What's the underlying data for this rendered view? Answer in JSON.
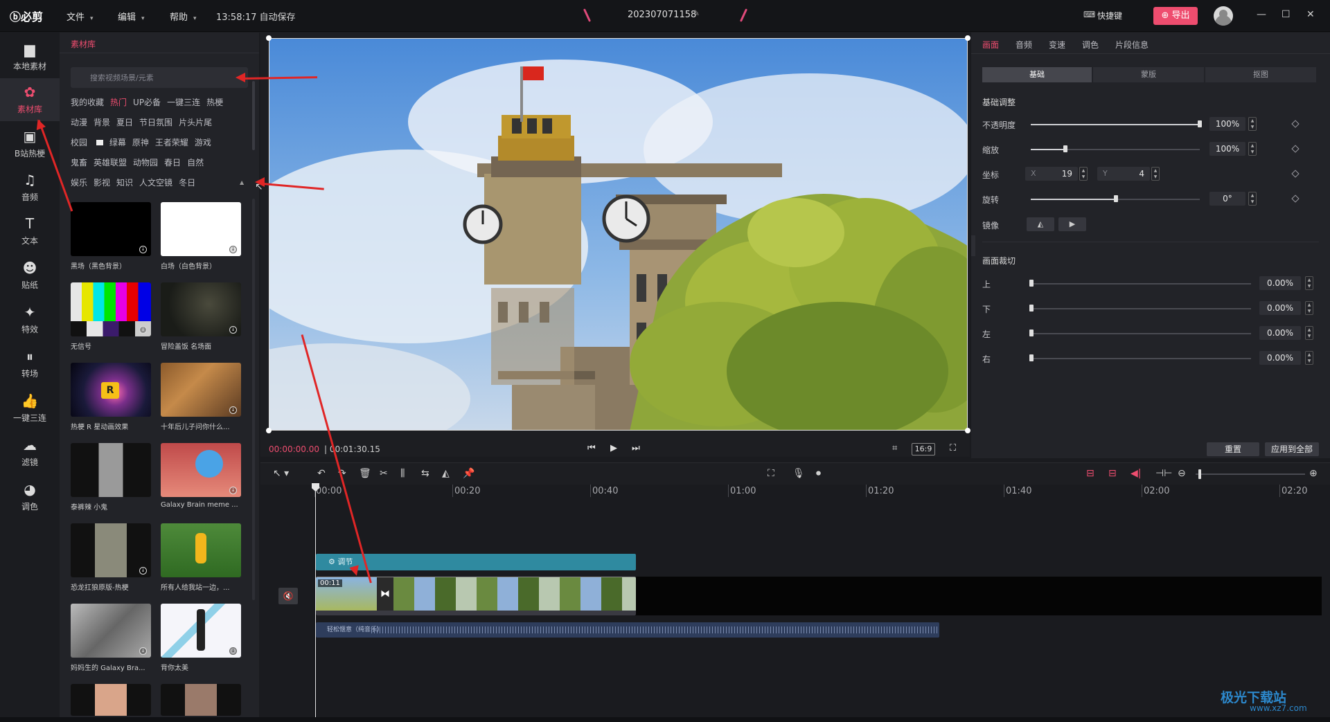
{
  "titlebar": {
    "logo": "必剪",
    "menus": [
      "文件",
      "编辑",
      "帮助"
    ],
    "autosave": "13:58:17 自动保存",
    "project_name": "202307071158",
    "hotkey": "快捷键",
    "export": "导出",
    "win_min": "—",
    "win_max": "☐",
    "win_close": "✕"
  },
  "sidebar": {
    "items": [
      {
        "icon": "folder-icon",
        "glyph": "▆",
        "label": "本地素材"
      },
      {
        "icon": "library-icon",
        "glyph": "✿",
        "label": "素材库"
      },
      {
        "icon": "bilibili-icon",
        "glyph": "▣",
        "label": "B站热梗"
      },
      {
        "icon": "music-icon",
        "glyph": "♫",
        "label": "音频"
      },
      {
        "icon": "text-icon",
        "glyph": "T",
        "label": "文本"
      },
      {
        "icon": "sticker-icon",
        "glyph": "☻",
        "label": "贴纸"
      },
      {
        "icon": "effects-icon",
        "glyph": "✦",
        "label": "特效"
      },
      {
        "icon": "transition-icon",
        "glyph": "⏸",
        "label": "转场"
      },
      {
        "icon": "thumbs-up-icon",
        "glyph": "👍",
        "label": "一键三连"
      },
      {
        "icon": "filter-icon",
        "glyph": "☁",
        "label": "滤镜"
      },
      {
        "icon": "palette-icon",
        "glyph": "◕",
        "label": "调色"
      }
    ]
  },
  "library": {
    "title": "素材库",
    "search_placeholder": "搜索视频场景/元素",
    "tag_rows": [
      [
        "我的收藏",
        "热门",
        "UP必备",
        "一键三连",
        "热梗"
      ],
      [
        "动漫",
        "背景",
        "夏日",
        "节日氛围",
        "片头片尾"
      ],
      [
        "校园",
        "绿幕",
        "原神",
        "王者荣耀",
        "游戏"
      ],
      [
        "鬼畜",
        "英雄联盟",
        "动物园",
        "春日",
        "自然"
      ],
      [
        "娱乐",
        "影视",
        "知识",
        "人文空镜",
        "冬日"
      ]
    ],
    "active_tag": "热门",
    "cards": [
      {
        "caption": "黑场（黑色背景）"
      },
      {
        "caption": "白场（白色背景）"
      },
      {
        "caption": "无信号"
      },
      {
        "caption": "冒险盖饭 名场面"
      },
      {
        "caption": "热梗 R 星动画效果"
      },
      {
        "caption": "十年后儿子问你什么..."
      },
      {
        "caption": "泰裤辣 小鬼"
      },
      {
        "caption": "Galaxy Brain meme ..."
      },
      {
        "caption": "恐龙扛狼原版-热梗"
      },
      {
        "caption": "所有人给我站一边，..."
      },
      {
        "caption": "妈妈生的 Galaxy Bra..."
      },
      {
        "caption": "背你太美"
      },
      {
        "caption": ""
      },
      {
        "caption": ""
      }
    ]
  },
  "preview": {
    "time_current": "00:00:00.00",
    "time_total": "| 00:01:30.15",
    "ratio": "16:9"
  },
  "props": {
    "tabs": [
      "画面",
      "音频",
      "变速",
      "调色",
      "片段信息"
    ],
    "active_tab": "画面",
    "segments": [
      "基础",
      "蒙版",
      "抠图"
    ],
    "basic_title": "基础调整",
    "opacity_label": "不透明度",
    "opacity_value": "100%",
    "scale_label": "缩放",
    "scale_value": "100%",
    "position_label": "坐标",
    "x_axis": "X",
    "x_value": "19",
    "y_axis": "Y",
    "y_value": "4",
    "rotate_label": "旋转",
    "rotate_value": "0°",
    "mirror_label": "镜像",
    "crop_title": "画面裁切",
    "crop": [
      {
        "label": "上",
        "value": "0.00%"
      },
      {
        "label": "下",
        "value": "0.00%"
      },
      {
        "label": "左",
        "value": "0.00%"
      },
      {
        "label": "右",
        "value": "0.00%"
      }
    ],
    "reset": "重置",
    "apply_all": "应用到全部"
  },
  "timeline": {
    "ruler": [
      "00:00",
      "00:20",
      "00:40",
      "01:00",
      "01:20",
      "01:40",
      "02:00",
      "02:20"
    ],
    "adjust_label": "调节",
    "clip_time": "00:11",
    "audio_label": "轻松惬意（纯音乐）"
  },
  "watermark": {
    "title": "极光下载站",
    "url": "www.xz7.com"
  },
  "colors": {
    "accent": "#ee4d6f",
    "adjust_track": "#2f8aa0",
    "audio_track": "#2e3d5c",
    "annotation": "#e02626"
  }
}
